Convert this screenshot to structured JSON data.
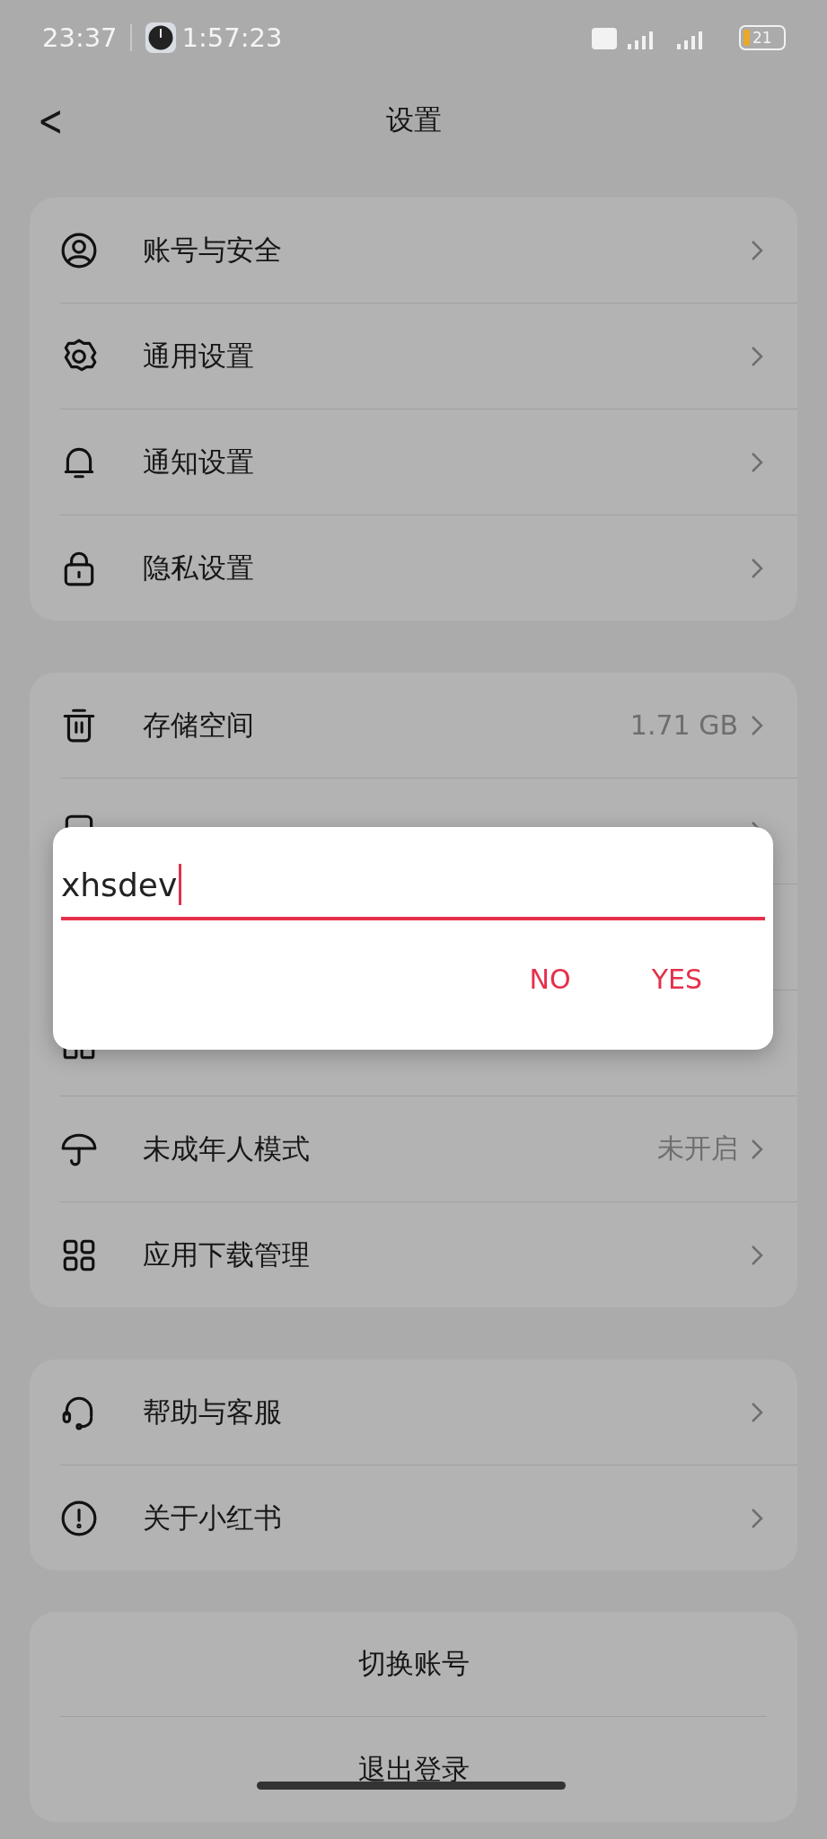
{
  "status_bar": {
    "time": "23:37",
    "timer": "1:57:23",
    "battery": "21"
  },
  "header": {
    "back": "<",
    "title": "设置"
  },
  "groups": [
    {
      "rows": [
        {
          "label": "账号与安全"
        },
        {
          "label": "通用设置"
        },
        {
          "label": "通知设置"
        },
        {
          "label": "隐私设置"
        }
      ]
    },
    {
      "rows": [
        {
          "label": "存储空间",
          "value": "1.71 GB"
        },
        {
          "kind": "covered"
        },
        {
          "kind": "hidden"
        },
        {
          "kind": "hidden"
        },
        {
          "label": "未成年人模式",
          "value": "未开启"
        },
        {
          "label": "应用下载管理"
        }
      ]
    },
    {
      "rows": [
        {
          "label": "帮助与客服"
        },
        {
          "label": "关于小红书"
        }
      ]
    }
  ],
  "account_actions": [
    "切换账号",
    "退出登录"
  ],
  "dialog": {
    "value": "xhsdev",
    "buttons": [
      "NO",
      "YES"
    ]
  }
}
